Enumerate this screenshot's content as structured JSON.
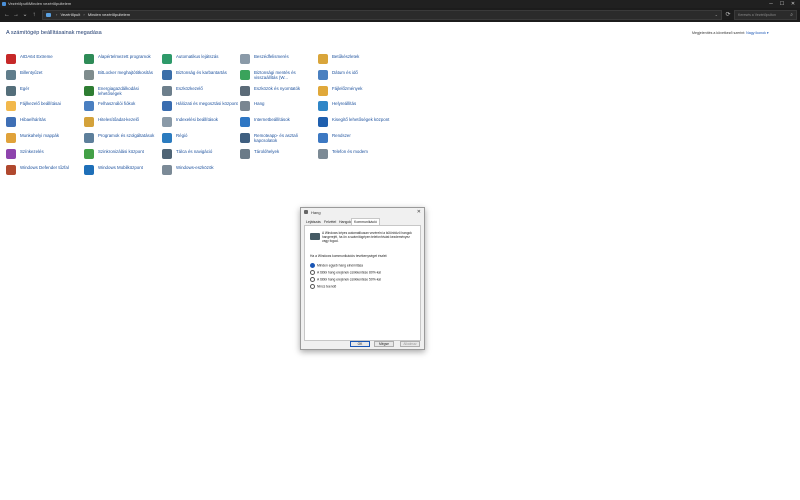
{
  "window": {
    "title": "Vezérlőpult\\Minden vezérlőpultelem",
    "min": "─",
    "max": "☐",
    "close": "✕"
  },
  "nav": {
    "back": "←",
    "forward": "→",
    "recent": "⌄",
    "up": "↑",
    "refresh": "⟳",
    "crumbs": [
      "Vezérlőpult",
      "Minden vezérlőpultelem"
    ],
    "search_placeholder": "Keresés a Vezérlőpulton"
  },
  "header": {
    "title": "A számítógép beállításainak megadása",
    "view_label": "Megjelenítés a következő szerint:",
    "view_value": "Nagy ikonok ▾"
  },
  "columns": [
    [
      {
        "label": "AIDA64 Extreme",
        "icon": "aida64-icon",
        "color": "#c62828"
      },
      {
        "label": "Billentyűzet",
        "icon": "keyboard-icon",
        "color": "#607d8b"
      },
      {
        "label": "Egér",
        "icon": "mouse-icon",
        "color": "#546e7a"
      },
      {
        "label": "Fájlkezelő beállításai",
        "icon": "folder-options-icon",
        "color": "#f2b84b"
      },
      {
        "label": "Hibaelhárítás",
        "icon": "troubleshooting-icon",
        "color": "#3f6fb5"
      },
      {
        "label": "Munkahelyi mappák",
        "icon": "work-folders-icon",
        "color": "#e0a23a"
      },
      {
        "label": "Színkezelés",
        "icon": "color-management-icon",
        "color": "#8e44ad"
      },
      {
        "label": "Windows Defender tűzfal",
        "icon": "firewall-icon",
        "color": "#b0482e"
      }
    ],
    [
      {
        "label": "Alapértelmezett programok",
        "icon": "default-programs-icon",
        "color": "#2e8b57"
      },
      {
        "label": "BitLocker meghajtótitkosítás",
        "icon": "bitlocker-icon",
        "color": "#7f8c8d"
      },
      {
        "label": "Energiagazdálkodási lehetőségek",
        "icon": "power-options-icon",
        "color": "#2e7d32"
      },
      {
        "label": "Felhasználói fiókok",
        "icon": "user-accounts-icon",
        "color": "#4a7fc1"
      },
      {
        "label": "Hitelesítőadat-kezelő",
        "icon": "credential-manager-icon",
        "color": "#d4a23a"
      },
      {
        "label": "Programok és szolgáltatások",
        "icon": "programs-features-icon",
        "color": "#5d7f9b"
      },
      {
        "label": "Szinkronizálási központ",
        "icon": "sync-center-icon",
        "color": "#43a047"
      },
      {
        "label": "Windows Mobilközpont",
        "icon": "mobility-center-icon",
        "color": "#1e6fb8"
      }
    ],
    [
      {
        "label": "Automatikus lejátszás",
        "icon": "autoplay-icon",
        "color": "#2e9a6a"
      },
      {
        "label": "Biztonság és karbantartás",
        "icon": "security-maintenance-icon",
        "color": "#3b6ea8"
      },
      {
        "label": "Eszközkezelő",
        "icon": "device-manager-icon",
        "color": "#6d7f8c"
      },
      {
        "label": "Hálózati és megosztási központ",
        "icon": "network-sharing-icon",
        "color": "#3a6db0"
      },
      {
        "label": "Indexelési beállítások",
        "icon": "indexing-icon",
        "color": "#8a9aa8"
      },
      {
        "label": "Régió",
        "icon": "region-icon",
        "color": "#2b7bbf"
      },
      {
        "label": "Tálca és navigáció",
        "icon": "taskbar-icon",
        "color": "#4f6475"
      },
      {
        "label": "Windows-eszközök",
        "icon": "windows-tools-icon",
        "color": "#7b8a97"
      }
    ],
    [
      {
        "label": "Beszédfelismerés",
        "icon": "speech-recognition-icon",
        "color": "#8a9aa8"
      },
      {
        "label": "Biztonsági mentés és visszaállítás (W...",
        "icon": "backup-restore-icon",
        "color": "#3aa35b"
      },
      {
        "label": "Eszközök és nyomtatók",
        "icon": "devices-printers-icon",
        "color": "#5b6b78"
      },
      {
        "label": "Hang",
        "icon": "sound-icon",
        "color": "#7a8691"
      },
      {
        "label": "Internetbeállítások",
        "icon": "internet-options-icon",
        "color": "#2f77c4"
      },
      {
        "label": "Remoteapp- és asztali kapcsolatok",
        "icon": "remoteapp-icon",
        "color": "#3f5f80"
      },
      {
        "label": "Tárolóhelyek",
        "icon": "storage-spaces-icon",
        "color": "#6b7b88"
      }
    ],
    [
      {
        "label": "Betűkészletek",
        "icon": "fonts-icon",
        "color": "#d9a53a"
      },
      {
        "label": "Dátum és idő",
        "icon": "date-time-icon",
        "color": "#4a80c0"
      },
      {
        "label": "Fájlelőzmények",
        "icon": "file-history-icon",
        "color": "#e0a83a"
      },
      {
        "label": "Helyreállítás",
        "icon": "recovery-icon",
        "color": "#2f86c7"
      },
      {
        "label": "Kisegítő lehetőségek központ",
        "icon": "ease-of-access-icon",
        "color": "#1f5fae"
      },
      {
        "label": "Rendszer",
        "icon": "system-icon",
        "color": "#3c78c2"
      },
      {
        "label": "Telefon és modem",
        "icon": "phone-modem-icon",
        "color": "#7c8a95"
      }
    ]
  ],
  "dialog": {
    "title": "Hang",
    "close": "✕",
    "tabs": [
      "Lejátszás",
      "Felvétel",
      "Hangok",
      "Kommunikáció"
    ],
    "description": "A Windows képes automatikusan vezérelni a különböző hangok hangerejét, ha ön a számítógépen telefonhívást kezdeményez vagy fogad.",
    "question": "Ha a Windows kommunikációs tevékenységet észlel:",
    "options": [
      "Minden egyéb hang elnémítása",
      "A többi hang erejének csökkentése 80%-kal",
      "A többi hang erejének csökkentése 50%-kal",
      "Nincs teendő"
    ],
    "selected_option": 0,
    "buttons": {
      "ok": "OK",
      "cancel": "Mégse",
      "apply": "Alkalmaz"
    }
  }
}
